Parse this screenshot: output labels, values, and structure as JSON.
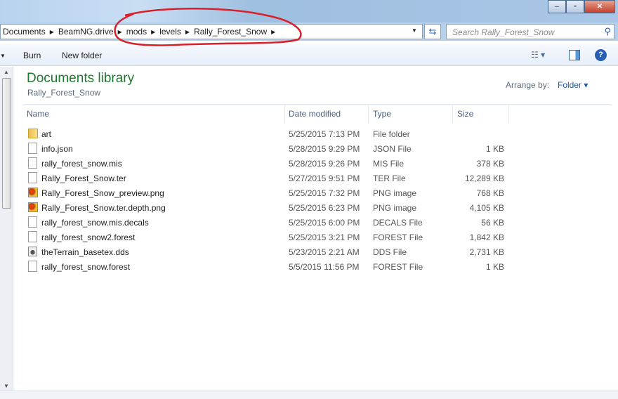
{
  "address": {
    "crumbs": [
      "Documents",
      "BeamNG.drive",
      "mods",
      "levels",
      "Rally_Forest_Snow"
    ]
  },
  "search": {
    "placeholder": "Search Rally_Forest_Snow"
  },
  "toolbar": {
    "burn": "Burn",
    "new_folder": "New folder"
  },
  "library": {
    "title": "Documents library",
    "subtitle": "Rally_Forest_Snow",
    "arrange_label": "Arrange by:",
    "arrange_value": "Folder"
  },
  "columns": {
    "name": "Name",
    "date": "Date modified",
    "type": "Type",
    "size": "Size"
  },
  "files": [
    {
      "icon": "folder",
      "name": "art",
      "date": "5/25/2015 7:13 PM",
      "type": "File folder",
      "size": ""
    },
    {
      "icon": "file",
      "name": "info.json",
      "date": "5/28/2015 9:29 PM",
      "type": "JSON File",
      "size": "1 KB"
    },
    {
      "icon": "file",
      "name": "rally_forest_snow.mis",
      "date": "5/28/2015 9:26 PM",
      "type": "MIS File",
      "size": "378 KB"
    },
    {
      "icon": "file",
      "name": "Rally_Forest_Snow.ter",
      "date": "5/27/2015 9:51 PM",
      "type": "TER File",
      "size": "12,289 KB"
    },
    {
      "icon": "png",
      "name": "Rally_Forest_Snow_preview.png",
      "date": "5/25/2015 7:32 PM",
      "type": "PNG image",
      "size": "768 KB"
    },
    {
      "icon": "png",
      "name": "Rally_Forest_Snow.ter.depth.png",
      "date": "5/25/2015 6:23 PM",
      "type": "PNG image",
      "size": "4,105 KB"
    },
    {
      "icon": "file",
      "name": "rally_forest_snow.mis.decals",
      "date": "5/25/2015 6:00 PM",
      "type": "DECALS File",
      "size": "56 KB"
    },
    {
      "icon": "file",
      "name": "rally_forest_snow2.forest",
      "date": "5/25/2015 3:21 PM",
      "type": "FOREST File",
      "size": "1,842 KB"
    },
    {
      "icon": "dds",
      "name": "theTerrain_basetex.dds",
      "date": "5/23/2015 2:21 AM",
      "type": "DDS File",
      "size": "2,731 KB"
    },
    {
      "icon": "file",
      "name": "rally_forest_snow.forest",
      "date": "5/5/2015 11:56 PM",
      "type": "FOREST File",
      "size": "1 KB"
    }
  ],
  "colors": {
    "annotation": "#d8202a",
    "library_title": "#1e7a2e"
  }
}
